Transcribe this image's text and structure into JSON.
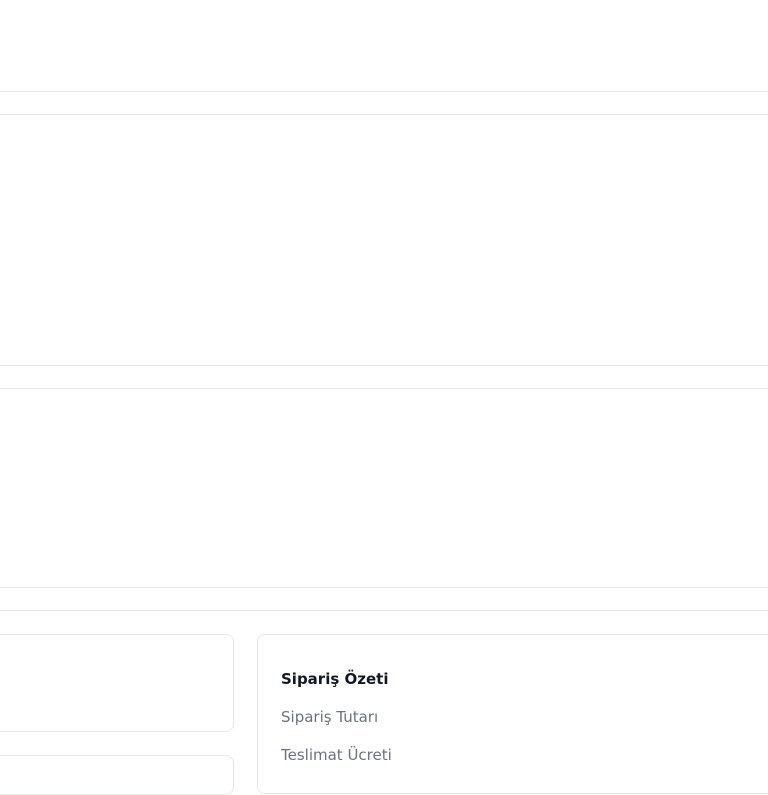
{
  "order_summary": {
    "title": "Sipariş Özeti",
    "rows": [
      {
        "label": "Sipariş Tutarı"
      },
      {
        "label": "Teslimat Ücreti"
      }
    ]
  }
}
